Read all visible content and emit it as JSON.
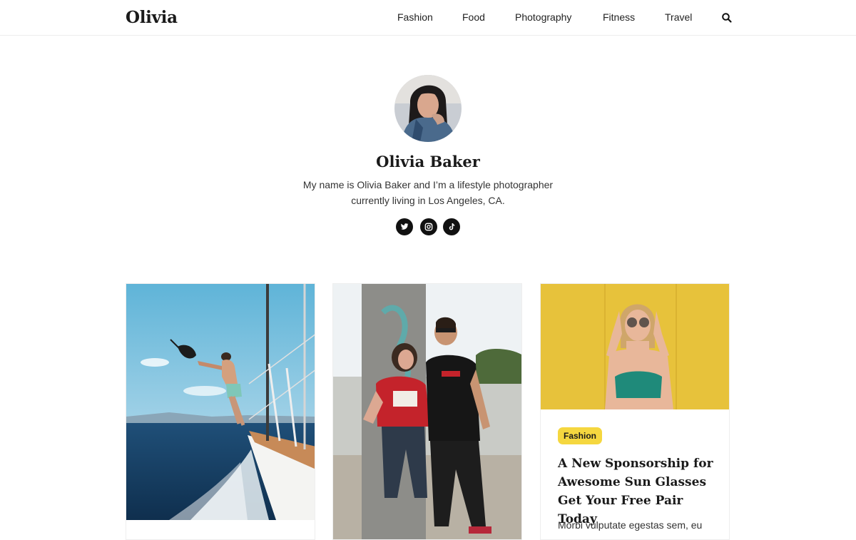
{
  "site": {
    "logo": "Olivia"
  },
  "nav": {
    "items": [
      {
        "label": "Fashion"
      },
      {
        "label": "Food"
      },
      {
        "label": "Photography"
      },
      {
        "label": "Fitness"
      },
      {
        "label": "Travel"
      }
    ],
    "search_icon": "search-icon"
  },
  "profile": {
    "name": "Olivia Baker",
    "bio": "My name is Olivia Baker and I’m a lifestyle photographer currently living in Los Angeles, CA.",
    "social": [
      {
        "icon": "twitter-icon"
      },
      {
        "icon": "instagram-icon"
      },
      {
        "icon": "tiktok-icon"
      }
    ]
  },
  "posts": [
    {
      "image": "man-on-sailboat-photo"
    },
    {
      "image": "couple-against-pillar-photo"
    },
    {
      "image": "woman-sunglasses-yellow-wall-photo",
      "category": "Fashion",
      "title": "A New Sponsorship for Awesome Sun Glasses Get Your Free Pair Today",
      "excerpt": "Morbi vulputate egestas sem, eu"
    }
  ],
  "colors": {
    "badge": "#f5d73f",
    "text": "#1a1a1a",
    "social_bg": "#111111"
  }
}
